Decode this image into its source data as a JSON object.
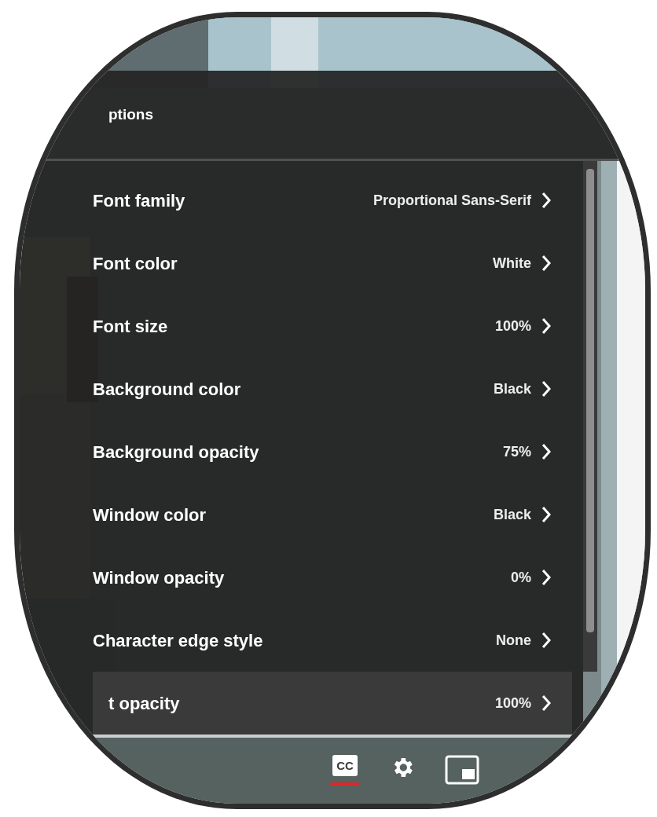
{
  "header": {
    "title": "ptions"
  },
  "options": [
    {
      "label": "Font family",
      "value": "Proportional Sans-Serif",
      "highlighted": false
    },
    {
      "label": "Font color",
      "value": "White",
      "highlighted": false
    },
    {
      "label": "Font size",
      "value": "100%",
      "highlighted": false
    },
    {
      "label": "Background color",
      "value": "Black",
      "highlighted": false
    },
    {
      "label": "Background opacity",
      "value": "75%",
      "highlighted": false
    },
    {
      "label": "Window color",
      "value": "Black",
      "highlighted": false
    },
    {
      "label": "Window opacity",
      "value": "0%",
      "highlighted": false
    },
    {
      "label": "Character edge style",
      "value": "None",
      "highlighted": false
    },
    {
      "label": "t opacity",
      "value": "100%",
      "highlighted": true
    }
  ],
  "controls": {
    "captions": {
      "label": "CC",
      "on": true
    }
  }
}
